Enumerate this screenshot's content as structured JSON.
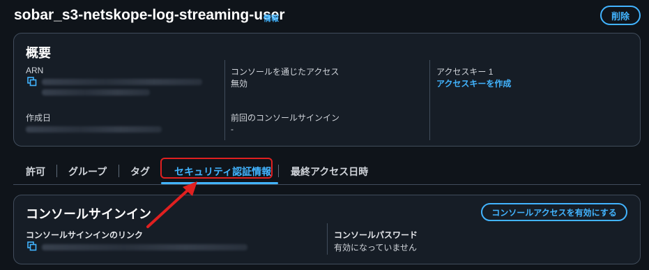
{
  "header": {
    "title": "sobar_s3-netskope-log-streaming-user",
    "info_link": "情報",
    "delete_button": "削除"
  },
  "summary": {
    "title": "概要",
    "arn_label": "ARN",
    "created_label": "作成日",
    "console_access_label": "コンソールを通じたアクセス",
    "console_access_value": "無効",
    "last_signin_label": "前回のコンソールサインイン",
    "last_signin_value": "-",
    "access_key_label": "アクセスキー 1",
    "access_key_link": "アクセスキーを作成"
  },
  "tabs": [
    {
      "label": "許可"
    },
    {
      "label": "グループ"
    },
    {
      "label": "タグ"
    },
    {
      "label": "セキュリティ認証情報",
      "active": true
    },
    {
      "label": "最終アクセス日時"
    }
  ],
  "console_signin": {
    "title": "コンソールサインイン",
    "enable_button": "コンソールアクセスを有効にする",
    "link_label": "コンソールサインインのリンク",
    "password_label": "コンソールパスワード",
    "password_value": "有効になっていません"
  },
  "colors": {
    "accent": "#42b4ff",
    "highlight": "#e02020",
    "background": "#0f141a",
    "card": "#161d26",
    "border": "#414d5c"
  },
  "icons": {
    "copy": "copy-icon"
  }
}
